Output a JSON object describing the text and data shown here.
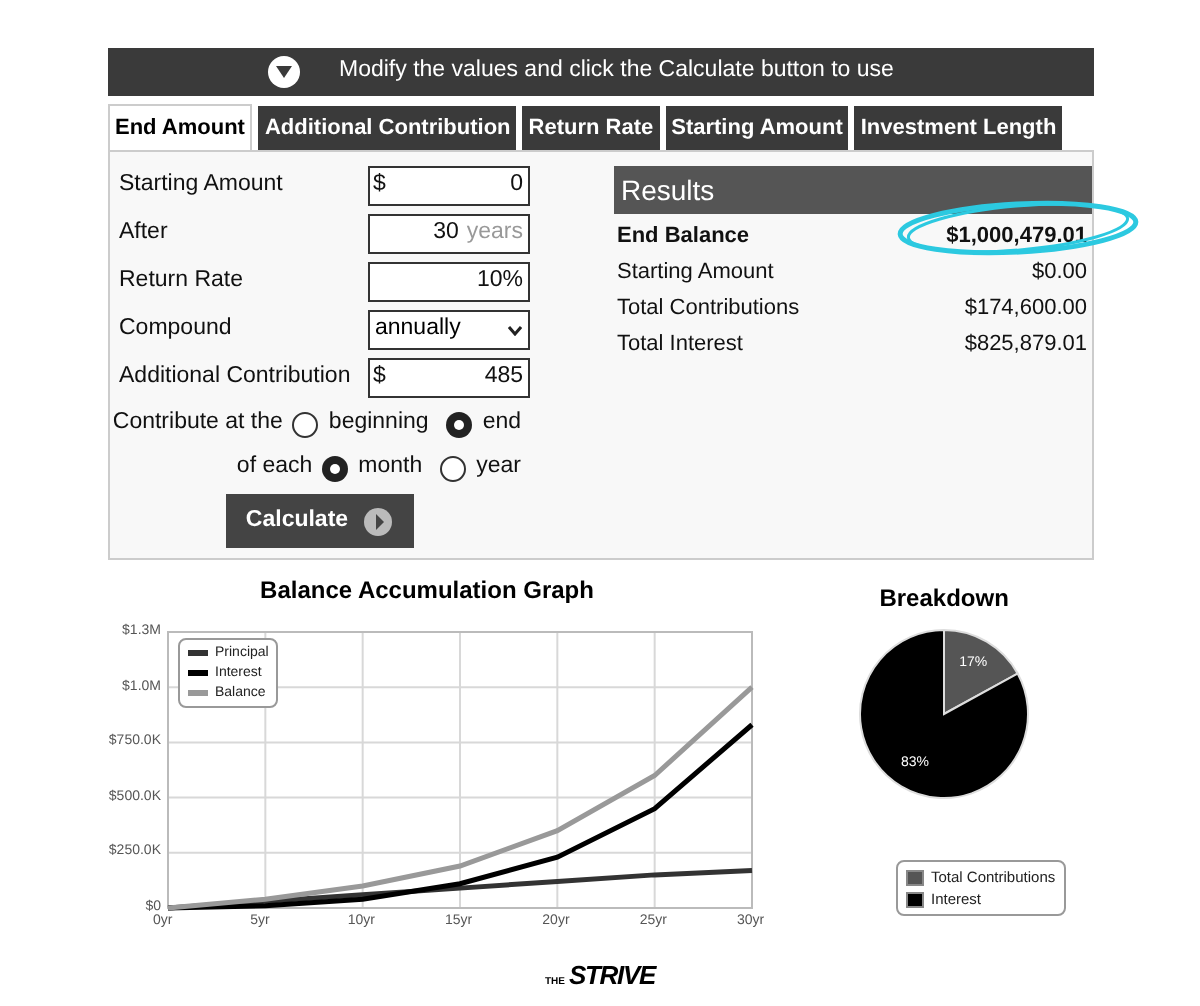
{
  "header": {
    "text": "Modify the values and click the Calculate button to use"
  },
  "tabs": [
    {
      "label": "End Amount",
      "selected": true
    },
    {
      "label": "Additional Contribution",
      "selected": false
    },
    {
      "label": "Return Rate",
      "selected": false
    },
    {
      "label": "Starting Amount",
      "selected": false
    },
    {
      "label": "Investment Length",
      "selected": false
    }
  ],
  "form": {
    "fields": [
      {
        "kind": "text",
        "label": "Starting Amount",
        "prefix": "$",
        "value": "0"
      },
      {
        "kind": "text",
        "label": "After",
        "value": "30",
        "suffix": "years"
      },
      {
        "kind": "text",
        "label": "Return Rate",
        "value": "10%"
      },
      {
        "kind": "select",
        "label": "Compound",
        "value": "annually"
      },
      {
        "kind": "text",
        "label": "Additional Contribution",
        "prefix": "$",
        "value": "485"
      }
    ],
    "timing": [
      {
        "label": "Contribute at the",
        "options": [
          {
            "label": "beginning",
            "selected": false
          },
          {
            "label": "end",
            "selected": true
          }
        ]
      },
      {
        "label": "of each",
        "options": [
          {
            "label": "month",
            "selected": true
          },
          {
            "label": "year",
            "selected": false
          }
        ]
      }
    ],
    "calculate_button": "Calculate"
  },
  "results": {
    "title": "Results",
    "rows": [
      {
        "label": "End Balance",
        "value": "$1,000,479.01",
        "bold": true
      },
      {
        "label": "Starting Amount",
        "value": "$0.00",
        "bold": false
      },
      {
        "label": "Total Contributions",
        "value": "$174,600.00",
        "bold": false
      },
      {
        "label": "Total Interest",
        "value": "$825,879.01",
        "bold": false
      }
    ]
  },
  "balance_graph": {
    "chart_data": {
      "type": "line",
      "title": "Balance Accumulation Graph",
      "x": [
        0,
        5,
        10,
        15,
        20,
        25,
        30
      ],
      "series": [
        {
          "name": "Principal",
          "color": "#333333",
          "values": [
            0,
            30000,
            60000,
            90000,
            120000,
            150000,
            170000
          ]
        },
        {
          "name": "Interest",
          "color": "#000000",
          "values": [
            0,
            10000,
            40000,
            110000,
            230000,
            450000,
            830000
          ]
        },
        {
          "name": "Balance",
          "color": "#999999",
          "values": [
            0,
            40000,
            100000,
            190000,
            350000,
            600000,
            1000000
          ]
        }
      ],
      "xlim": [
        0,
        30
      ],
      "ylim": [
        0,
        1250000
      ],
      "grid": true,
      "legend": true,
      "xticks": [
        {
          "value": 0,
          "label": "0yr"
        },
        {
          "value": 5,
          "label": "5yr"
        },
        {
          "value": 10,
          "label": "10yr"
        },
        {
          "value": 15,
          "label": "15yr"
        },
        {
          "value": 20,
          "label": "20yr"
        },
        {
          "value": 25,
          "label": "25yr"
        },
        {
          "value": 30,
          "label": "30yr"
        }
      ],
      "yticks": [
        {
          "value": 0,
          "label": "$0"
        },
        {
          "value": 250000,
          "label": "$250.0K"
        },
        {
          "value": 500000,
          "label": "$500.0K"
        },
        {
          "value": 750000,
          "label": "$750.0K"
        },
        {
          "value": 1000000,
          "label": "$1.0M"
        },
        {
          "value": 1250000,
          "label": "$1.3M"
        }
      ]
    }
  },
  "breakdown": {
    "chart_data": {
      "type": "pie",
      "title": "Breakdown",
      "categories": [
        "Total Contributions",
        "Interest"
      ],
      "values": [
        17,
        83
      ],
      "colors": [
        "#555555",
        "#000000"
      ],
      "value_labels": [
        "17%",
        "83%"
      ],
      "legend": true
    }
  },
  "footer": {
    "logo_prefix": "THE",
    "logo_name": "STRIVE"
  }
}
